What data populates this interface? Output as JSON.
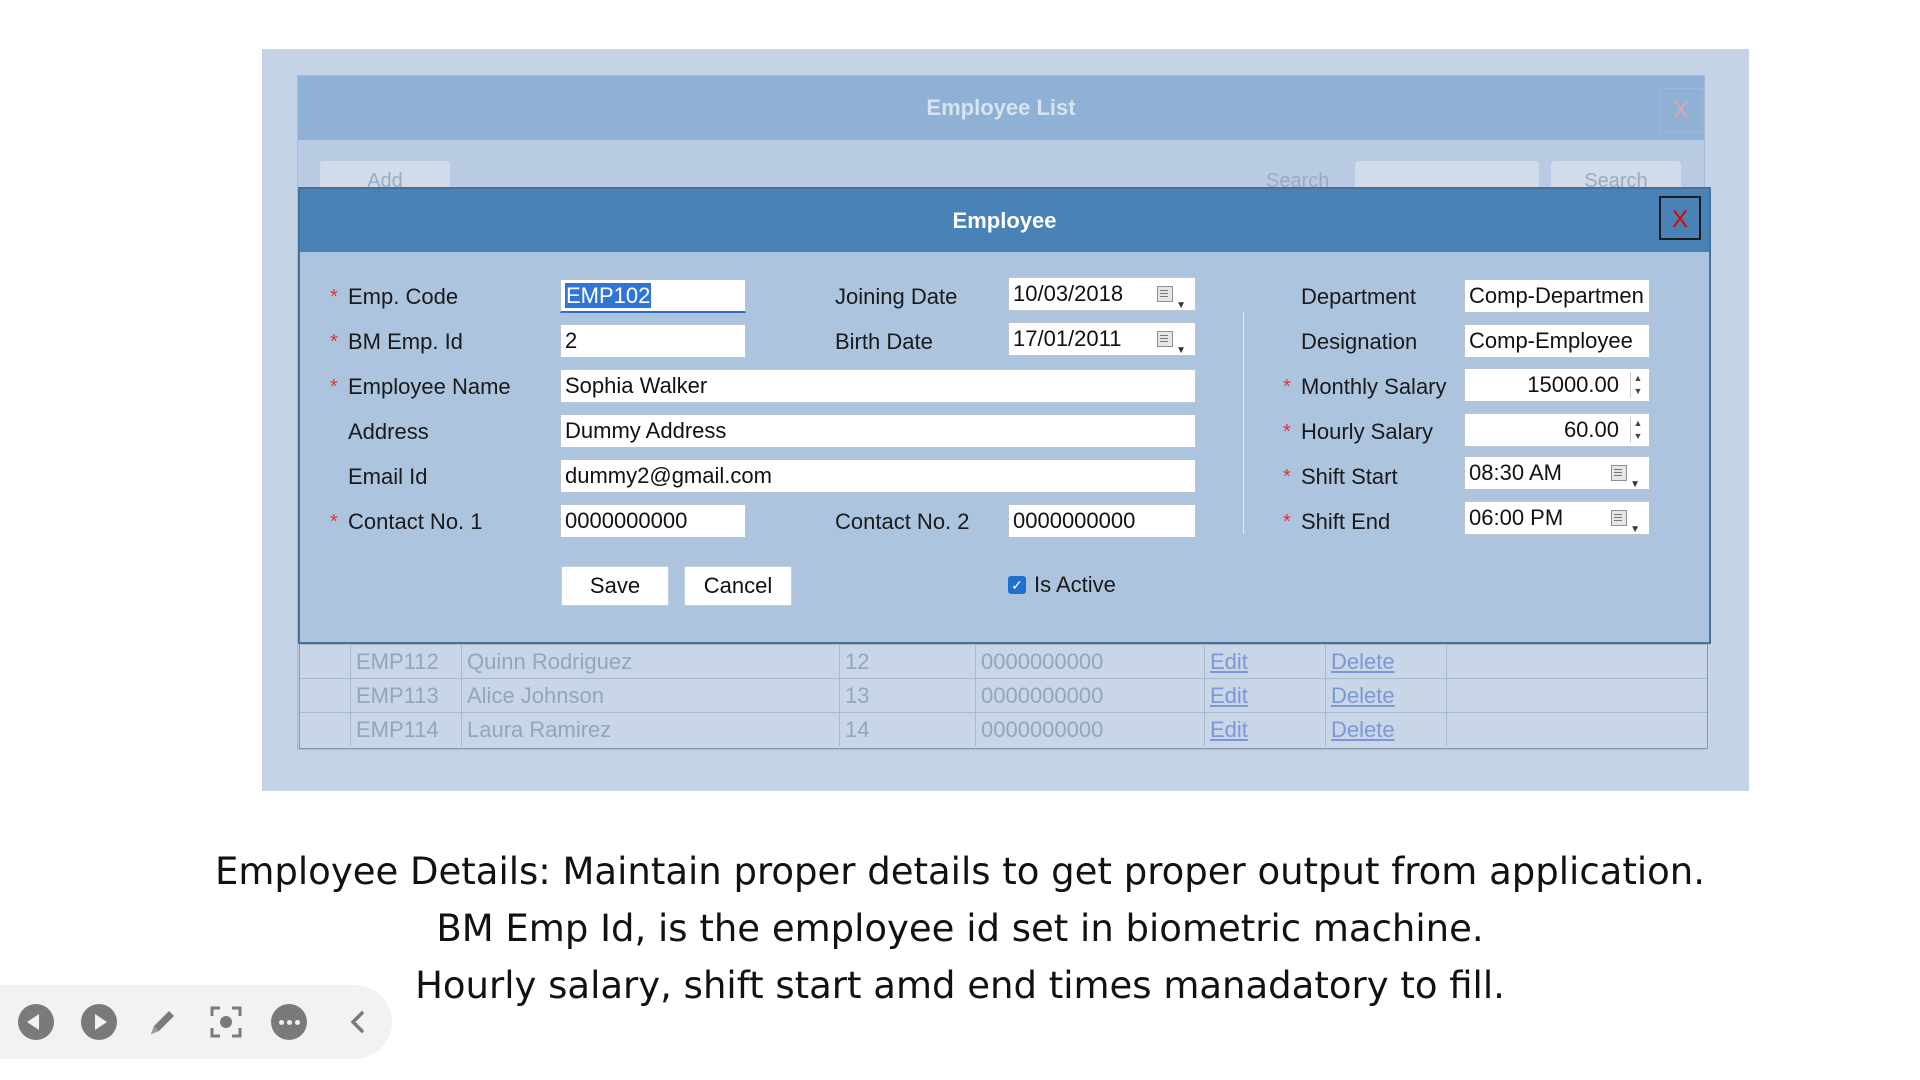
{
  "list_window": {
    "title": "Employee List",
    "close": "X",
    "add_button": "Add",
    "search_label": "Search",
    "search_button": "Search",
    "rows": [
      {
        "code": "EMP112",
        "name": "Quinn Rodriguez",
        "bm_id": "12",
        "contact": "0000000000",
        "edit": "Edit",
        "delete": "Delete"
      },
      {
        "code": "EMP113",
        "name": "Alice Johnson",
        "bm_id": "13",
        "contact": "0000000000",
        "edit": "Edit",
        "delete": "Delete"
      },
      {
        "code": "EMP114",
        "name": "Laura Ramirez",
        "bm_id": "14",
        "contact": "0000000000",
        "edit": "Edit",
        "delete": "Delete"
      }
    ]
  },
  "dialog": {
    "title": "Employee",
    "close": "X",
    "required_mark": "*",
    "fields": {
      "emp_code": {
        "label": "Emp. Code",
        "value": "EMP102"
      },
      "bm_emp_id": {
        "label": "BM Emp. Id",
        "value": "2"
      },
      "employee_name": {
        "label": "Employee Name",
        "value": "Sophia Walker"
      },
      "address": {
        "label": "Address",
        "value": "Dummy Address"
      },
      "email": {
        "label": "Email Id",
        "value": "dummy2@gmail.com"
      },
      "contact1": {
        "label": "Contact No. 1",
        "value": "0000000000"
      },
      "joining_date": {
        "label": "Joining Date",
        "value": "10/03/2018"
      },
      "birth_date": {
        "label": "Birth Date",
        "value": "17/01/2011"
      },
      "contact2": {
        "label": "Contact No. 2",
        "value": "0000000000"
      },
      "department": {
        "label": "Department",
        "value": "Comp-Departmen"
      },
      "designation": {
        "label": "Designation",
        "value": "Comp-Employee"
      },
      "monthly_salary": {
        "label": "Monthly Salary",
        "value": "15000.00"
      },
      "hourly_salary": {
        "label": "Hourly Salary",
        "value": "60.00"
      },
      "shift_start": {
        "label": "Shift Start",
        "value": "08:30 AM"
      },
      "shift_end": {
        "label": "Shift End",
        "value": "06:00 PM"
      }
    },
    "save_button": "Save",
    "cancel_button": "Cancel",
    "is_active": {
      "label": "Is Active",
      "checked": true
    }
  },
  "caption": {
    "line1": "Employee Details: Maintain proper details to get proper output from application.",
    "line2": "BM Emp Id, is the employee id set in biometric machine.",
    "line3": "Hourly salary, shift start amd end times manadatory to fill."
  },
  "toolbar": {
    "icons": [
      "previous-icon",
      "next-icon",
      "pen-icon",
      "focus-icon",
      "more-icon",
      "collapse-icon"
    ]
  },
  "colors": {
    "dialog_titlebar": "#4982b6",
    "dialog_body": "#adc4df",
    "required": "#e23333",
    "close_x": "#e60000",
    "link": "#7d97d6"
  }
}
